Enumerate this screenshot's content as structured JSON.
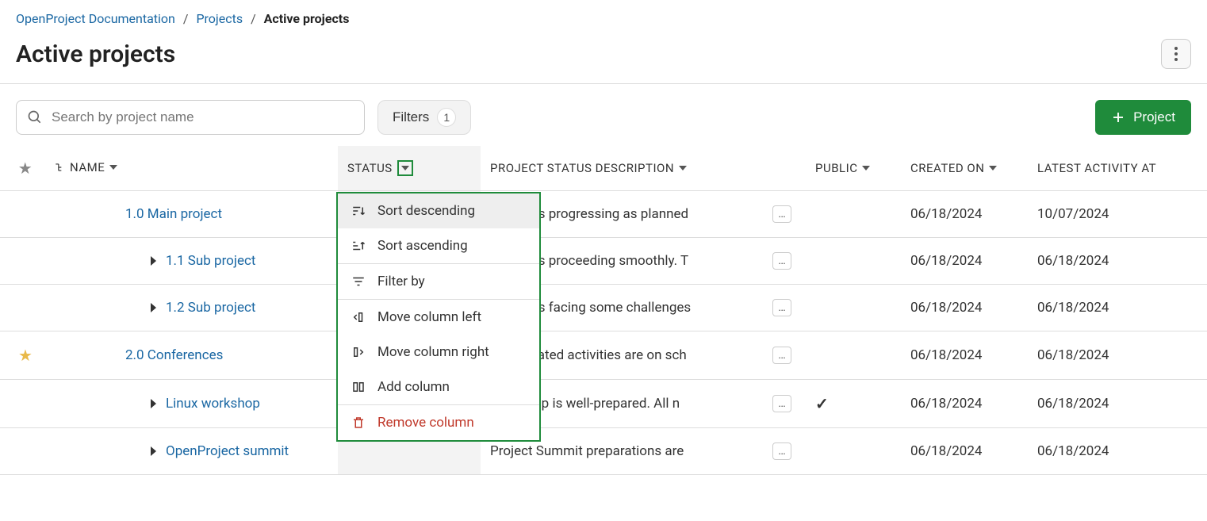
{
  "breadcrumb": {
    "root": "OpenProject Documentation",
    "mid": "Projects",
    "current": "Active projects"
  },
  "page_title": "Active projects",
  "search": {
    "placeholder": "Search by project name"
  },
  "filters": {
    "label": "Filters",
    "count": "1"
  },
  "add_project_label": "Project",
  "columns": {
    "name": "NAME",
    "status": "STATUS",
    "desc": "PROJECT STATUS DESCRIPTION",
    "public": "PUBLIC",
    "created": "CREATED ON",
    "activity": "LATEST ACTIVITY AT"
  },
  "dropdown": {
    "sort_desc": "Sort descending",
    "sort_asc": "Sort ascending",
    "filter_by": "Filter by",
    "move_left": "Move column left",
    "move_right": "Move column right",
    "add_col": "Add column",
    "remove_col": "Remove column"
  },
  "rows": [
    {
      "star": false,
      "indent": 1,
      "expand": false,
      "name": "1.0 Main project",
      "desc": "project is progressing as planned",
      "public": "",
      "created": "06/18/2024",
      "activity": "10/07/2024"
    },
    {
      "star": false,
      "indent": 2,
      "expand": true,
      "name": "1.1 Sub project",
      "desc": "project is proceeding smoothly. T",
      "public": "",
      "created": "06/18/2024",
      "activity": "06/18/2024"
    },
    {
      "star": false,
      "indent": 2,
      "expand": true,
      "name": "1.2 Sub project",
      "desc": "project is facing some challenges",
      "public": "",
      "created": "06/18/2024",
      "activity": "06/18/2024"
    },
    {
      "star": true,
      "indent": 1,
      "expand": false,
      "name": "2.0 Conferences",
      "desc": "ence-related activities are on sch",
      "public": "",
      "created": "06/18/2024",
      "activity": "06/18/2024"
    },
    {
      "star": false,
      "indent": 2,
      "expand": true,
      "name": "Linux workshop",
      "desc": "workshop is well-prepared. All n",
      "public": "✓",
      "created": "06/18/2024",
      "activity": "06/18/2024"
    },
    {
      "star": false,
      "indent": 2,
      "expand": true,
      "name": "OpenProject summit",
      "desc": "Project Summit preparations are",
      "public": "",
      "created": "06/18/2024",
      "activity": "06/18/2024"
    }
  ]
}
